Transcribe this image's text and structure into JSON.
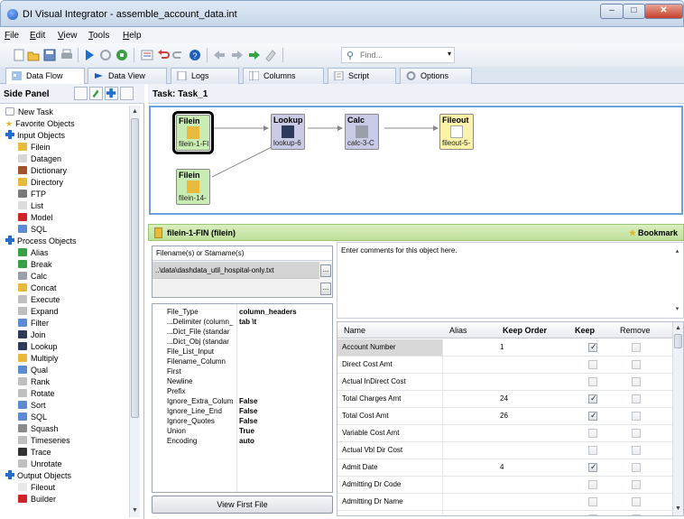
{
  "window": {
    "title": "DI Visual Integrator - assemble_account_data.int"
  },
  "menu": [
    "File",
    "Edit",
    "View",
    "Tools",
    "Help"
  ],
  "toolbar": {
    "find_placeholder": "Find..."
  },
  "tabs": [
    {
      "label": "Data Flow",
      "active": true
    },
    {
      "label": "Data View",
      "active": false
    },
    {
      "label": "Logs",
      "active": false
    },
    {
      "label": "Columns",
      "active": false
    },
    {
      "label": "Script",
      "active": false
    },
    {
      "label": "Options",
      "active": false
    }
  ],
  "side_panel": {
    "title": "Side Panel",
    "items": [
      {
        "label": "New Task",
        "kind": "item",
        "color": "#ffffff"
      },
      {
        "label": "Favorite Objects",
        "kind": "star",
        "color": "#e6b422"
      },
      {
        "label": "Input Objects",
        "kind": "group",
        "color": "#1f6fd1"
      },
      {
        "label": "Filein",
        "kind": "child",
        "color": "#e8b93a"
      },
      {
        "label": "Datagen",
        "kind": "child",
        "color": "#d6d6d6"
      },
      {
        "label": "Dictionary",
        "kind": "child",
        "color": "#a0522d"
      },
      {
        "label": "Directory",
        "kind": "child",
        "color": "#e8b93a"
      },
      {
        "label": "FTP",
        "kind": "child",
        "color": "#7a7a7a"
      },
      {
        "label": "List",
        "kind": "child",
        "color": "#dcdcdc"
      },
      {
        "label": "Model",
        "kind": "child",
        "color": "#d0202a"
      },
      {
        "label": "SQL",
        "kind": "child",
        "color": "#5b8bd0"
      },
      {
        "label": "Process Objects",
        "kind": "group",
        "color": "#1f6fd1"
      },
      {
        "label": "Alias",
        "kind": "child",
        "color": "#3aa046"
      },
      {
        "label": "Break",
        "kind": "child",
        "color": "#3aa046"
      },
      {
        "label": "Calc",
        "kind": "child",
        "color": "#9aa0aa"
      },
      {
        "label": "Concat",
        "kind": "child",
        "color": "#e8b93a"
      },
      {
        "label": "Execute",
        "kind": "child",
        "color": "#bfbfbf"
      },
      {
        "label": "Expand",
        "kind": "child",
        "color": "#bfbfbf"
      },
      {
        "label": "Filter",
        "kind": "child",
        "color": "#5b8bd0"
      },
      {
        "label": "Join",
        "kind": "child",
        "color": "#2d3a5a"
      },
      {
        "label": "Lookup",
        "kind": "child",
        "color": "#2d3a5a"
      },
      {
        "label": "Multiply",
        "kind": "child",
        "color": "#e8b93a"
      },
      {
        "label": "Qual",
        "kind": "child",
        "color": "#5b8bd0"
      },
      {
        "label": "Rank",
        "kind": "child",
        "color": "#bfbfbf"
      },
      {
        "label": "Rotate",
        "kind": "child",
        "color": "#bfbfbf"
      },
      {
        "label": "Sort",
        "kind": "child",
        "color": "#5b8bd0"
      },
      {
        "label": "SQL",
        "kind": "child",
        "color": "#5b8bd0"
      },
      {
        "label": "Squash",
        "kind": "child",
        "color": "#8a8a8a"
      },
      {
        "label": "Timeseries",
        "kind": "child",
        "color": "#bfbfbf"
      },
      {
        "label": "Trace",
        "kind": "child",
        "color": "#333333"
      },
      {
        "label": "Unrotate",
        "kind": "child",
        "color": "#bfbfbf"
      },
      {
        "label": "Output Objects",
        "kind": "group",
        "color": "#1f6fd1"
      },
      {
        "label": "Fileout",
        "kind": "child",
        "color": "#e8e8e8"
      },
      {
        "label": "Builder",
        "kind": "child",
        "color": "#d0202a"
      }
    ]
  },
  "task": {
    "title": "Task: Task_1"
  },
  "flow_nodes": [
    {
      "type": "Filein",
      "name": "filein-1-FI",
      "style": "filein",
      "selected": true
    },
    {
      "type": "Lookup",
      "name": "lookup-6",
      "style": "lookup",
      "selected": false
    },
    {
      "type": "Calc",
      "name": "calc-3-C",
      "style": "calc",
      "selected": false
    },
    {
      "type": "Fileout",
      "name": "fileout-5-",
      "style": "fileout",
      "selected": false
    },
    {
      "type": "Filein",
      "name": "filein-14-",
      "style": "filein",
      "selected": false
    }
  ],
  "object_panel": {
    "title": "filein-1-FIN (filein)",
    "bookmark_label": "Bookmark",
    "filename_header": "Filename(s) or Stamame(s)",
    "filename_value": "..\\data\\dashdata_util_hospital-only.txt",
    "ellipsis": "...",
    "comments_placeholder": "Enter comments for this object here.",
    "view_button": "View First File",
    "properties": [
      {
        "key": "File_Type",
        "value": "column_headers"
      },
      {
        "key": "...Delimiter (column_",
        "value": "tab \\t"
      },
      {
        "key": "...Dict_File (standar",
        "value": ""
      },
      {
        "key": "...Dict_Obj (standar",
        "value": ""
      },
      {
        "key": "File_List_Input",
        "value": ""
      },
      {
        "key": "Filename_Column",
        "value": ""
      },
      {
        "key": "First",
        "value": ""
      },
      {
        "key": "Newline",
        "value": ""
      },
      {
        "key": "Prefix",
        "value": ""
      },
      {
        "key": "Ignore_Extra_Colum",
        "value": "False"
      },
      {
        "key": "Ignore_Line_End",
        "value": "False"
      },
      {
        "key": "Ignore_Quotes",
        "value": "False"
      },
      {
        "key": "Union",
        "value": "True"
      },
      {
        "key": "Encoding",
        "value": "auto"
      }
    ]
  },
  "columns_grid": {
    "headers": {
      "name": "Name",
      "alias": "Alias",
      "keep_order": "Keep Order",
      "keep": "Keep",
      "remove": "Remove"
    },
    "rows": [
      {
        "name": "Account Number",
        "alias": "",
        "keep_order": "1",
        "keep": true,
        "remove": false
      },
      {
        "name": "Direct Cost Amt",
        "alias": "",
        "keep_order": "",
        "keep": false,
        "remove": false
      },
      {
        "name": "Actual InDirect Cost",
        "alias": "",
        "keep_order": "",
        "keep": false,
        "remove": false
      },
      {
        "name": "Total Charges Amt",
        "alias": "",
        "keep_order": "24",
        "keep": true,
        "remove": false
      },
      {
        "name": "Total Cost Amt",
        "alias": "",
        "keep_order": "26",
        "keep": true,
        "remove": false
      },
      {
        "name": "Variable Cost Amt",
        "alias": "",
        "keep_order": "",
        "keep": false,
        "remove": false
      },
      {
        "name": "Actual Vbl Dir Cost",
        "alias": "",
        "keep_order": "",
        "keep": false,
        "remove": false
      },
      {
        "name": "Admit Date",
        "alias": "",
        "keep_order": "4",
        "keep": true,
        "remove": false
      },
      {
        "name": "Admitting Dr Code",
        "alias": "",
        "keep_order": "",
        "keep": false,
        "remove": false
      },
      {
        "name": "Admitting Dr Name",
        "alias": "",
        "keep_order": "",
        "keep": false,
        "remove": false
      },
      {
        "name": "",
        "alias": "",
        "keep_order": "",
        "keep": false,
        "remove": false
      }
    ]
  }
}
